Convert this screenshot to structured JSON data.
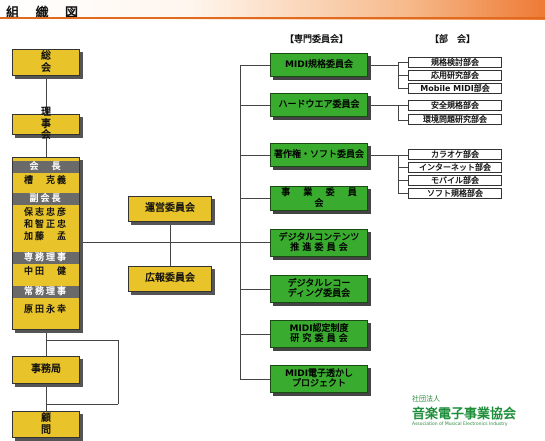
{
  "page_title": "組 織 図",
  "headers": {
    "committees": "【専門委員会】",
    "subcommittees": "【部　会】"
  },
  "left": {
    "general_meeting": "総　会",
    "board": "理　事　会",
    "officers": [
      {
        "role": "会　長",
        "names": [
          "槽　克義"
        ]
      },
      {
        "role": "副会長",
        "names": [
          "保志忠彦",
          "和智正忠",
          "加藤　孟"
        ]
      },
      {
        "role": "専務理事",
        "names": [
          "中田　健"
        ]
      },
      {
        "role": "常務理事",
        "names": [
          "原田永幸"
        ]
      }
    ],
    "secretariat": "事務局",
    "advisors": "顧　問"
  },
  "middle": {
    "steering": "運営委員会",
    "pr": "広報委員会"
  },
  "committees": [
    {
      "label": "MIDI規格委員会",
      "subs": [
        "規格検討部会",
        "応用研究部会",
        "Mobile MIDI部会"
      ]
    },
    {
      "label": "ハードウエア委員会",
      "subs": [
        "安全規格部会",
        "環境問題研究部会"
      ]
    },
    {
      "label": "著作権・ソフト委員会",
      "subs": [
        "カラオケ部会",
        "インターネット部会",
        "モバイル部会",
        "ソフト規格部会"
      ]
    },
    {
      "label": "事 業 委 員 会",
      "subs": []
    },
    {
      "label": "デジタルコンテンツ\n推 進 委 員 会",
      "subs": []
    },
    {
      "label": "デジタルレコー\nディング委員会",
      "subs": []
    },
    {
      "label": "MIDI認定制度\n研 究 委 員 会",
      "subs": []
    },
    {
      "label": "MIDI電子透かし\nプロジェクト",
      "subs": []
    }
  ],
  "logo": {
    "sub": "社団法人",
    "name": "音楽電子事業協会",
    "english": "Association of Musical Electronics Industry"
  }
}
